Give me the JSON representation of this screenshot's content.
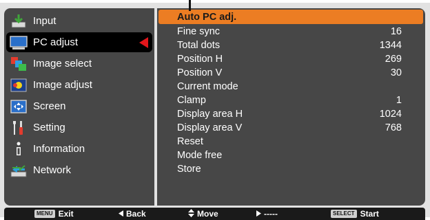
{
  "menu": {
    "items": [
      {
        "label": "Input",
        "icon": "input-icon"
      },
      {
        "label": "PC adjust",
        "icon": "monitor-icon"
      },
      {
        "label": "Image select",
        "icon": "image-select-icon"
      },
      {
        "label": "Image adjust",
        "icon": "image-adjust-icon"
      },
      {
        "label": "Screen",
        "icon": "screen-icon"
      },
      {
        "label": "Setting",
        "icon": "wrench-screwdriver-icon"
      },
      {
        "label": "Information",
        "icon": "info-icon"
      },
      {
        "label": "Network",
        "icon": "network-icon"
      }
    ],
    "selected": "PC adjust"
  },
  "submenu": {
    "rows": [
      {
        "label": "Auto PC adj.",
        "value": ""
      },
      {
        "label": "Fine sync",
        "value": "16"
      },
      {
        "label": "Total dots",
        "value": "1344"
      },
      {
        "label": "Position H",
        "value": "269"
      },
      {
        "label": "Position V",
        "value": "30"
      },
      {
        "label": "Current mode",
        "value": ""
      },
      {
        "label": "Clamp",
        "value": "1"
      },
      {
        "label": "Display area H",
        "value": "1024"
      },
      {
        "label": "Display area V",
        "value": "768"
      },
      {
        "label": "Reset",
        "value": ""
      },
      {
        "label": "Mode free",
        "value": ""
      },
      {
        "label": "Store",
        "value": ""
      }
    ],
    "highlighted": "Auto PC adj."
  },
  "footer": {
    "exit": {
      "key": "MENU",
      "label": "Exit"
    },
    "back": {
      "label": "Back"
    },
    "move": {
      "label": "Move"
    },
    "next": {
      "label": "-----"
    },
    "start": {
      "key": "SELECT",
      "label": "Start"
    }
  },
  "colors": {
    "panel": "#474747",
    "highlight": "#ec7d23",
    "selected_arrow": "#e2161b",
    "frame": "#e2e2e2"
  }
}
